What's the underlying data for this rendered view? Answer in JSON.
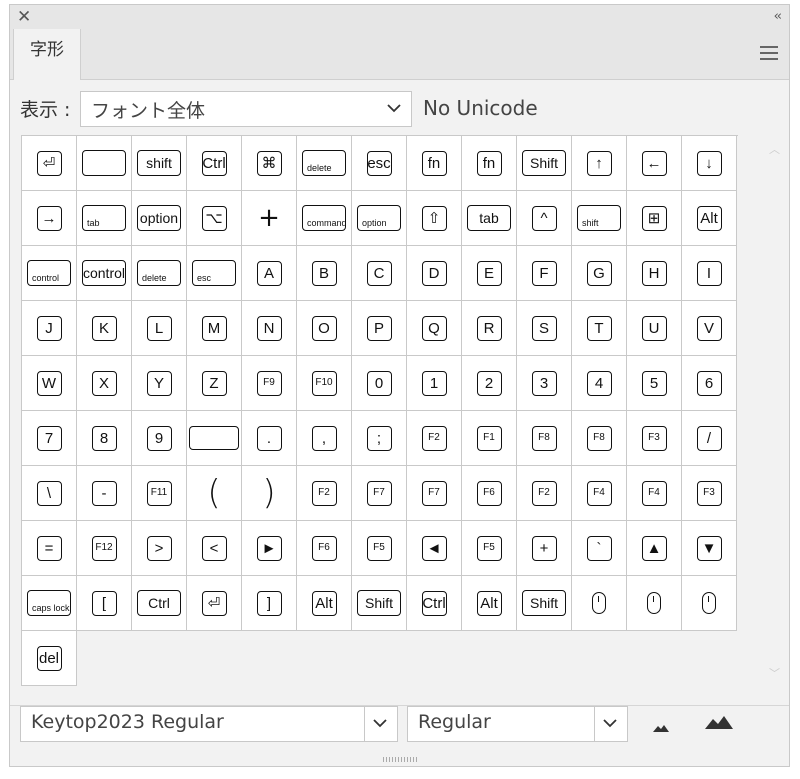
{
  "window": {
    "close_icon": "close-icon",
    "collapse_glyph": "‹‹"
  },
  "tab": {
    "label": "字形"
  },
  "show": {
    "label": "表示 :",
    "value": "フォント全体",
    "unicode": "No Unicode"
  },
  "glyphs": [
    {
      "t": "sq",
      "v": "⏎"
    },
    {
      "t": "blank"
    },
    {
      "t": "wide",
      "v": "shift"
    },
    {
      "t": "sq",
      "v": "Ctrl"
    },
    {
      "t": "sq",
      "v": "⌘"
    },
    {
      "t": "lbl",
      "v": "delete"
    },
    {
      "t": "sq",
      "v": "esc"
    },
    {
      "t": "sq",
      "v": "fn"
    },
    {
      "t": "sq",
      "v": "fn"
    },
    {
      "t": "wide",
      "v": "Shift"
    },
    {
      "t": "sq",
      "v": "↑"
    },
    {
      "t": "sq",
      "v": "←"
    },
    {
      "t": "sq",
      "v": "↓"
    },
    {
      "t": "sq",
      "v": "→"
    },
    {
      "t": "lbl",
      "v": "tab"
    },
    {
      "t": "wide",
      "v": "option"
    },
    {
      "t": "sq",
      "v": "⌥"
    },
    {
      "t": "plain",
      "v": "+"
    },
    {
      "t": "lbl",
      "v": "command"
    },
    {
      "t": "lbl",
      "v": "option"
    },
    {
      "t": "sq",
      "v": "⇧"
    },
    {
      "t": "wide",
      "v": "tab"
    },
    {
      "t": "sq",
      "v": "^"
    },
    {
      "t": "lbl",
      "v": "shift"
    },
    {
      "t": "sq",
      "v": "⊞"
    },
    {
      "t": "sq",
      "v": "Alt"
    },
    {
      "t": "lbl",
      "v": "control"
    },
    {
      "t": "wide",
      "v": "control"
    },
    {
      "t": "lbl",
      "v": "delete"
    },
    {
      "t": "lbl",
      "v": "esc"
    },
    {
      "t": "sq",
      "v": "A"
    },
    {
      "t": "sq",
      "v": "B"
    },
    {
      "t": "sq",
      "v": "C"
    },
    {
      "t": "sq",
      "v": "D"
    },
    {
      "t": "sq",
      "v": "E"
    },
    {
      "t": "sq",
      "v": "F"
    },
    {
      "t": "sq",
      "v": "G"
    },
    {
      "t": "sq",
      "v": "H"
    },
    {
      "t": "sq",
      "v": "I"
    },
    {
      "t": "sq",
      "v": "J"
    },
    {
      "t": "sq",
      "v": "K"
    },
    {
      "t": "sq",
      "v": "L"
    },
    {
      "t": "sq",
      "v": "M"
    },
    {
      "t": "sq",
      "v": "N"
    },
    {
      "t": "sq",
      "v": "O"
    },
    {
      "t": "sq",
      "v": "P"
    },
    {
      "t": "sq",
      "v": "Q"
    },
    {
      "t": "sq",
      "v": "R"
    },
    {
      "t": "sq",
      "v": "S"
    },
    {
      "t": "sq",
      "v": "T"
    },
    {
      "t": "sq",
      "v": "U"
    },
    {
      "t": "sq",
      "v": "V"
    },
    {
      "t": "sq",
      "v": "W"
    },
    {
      "t": "sq",
      "v": "X"
    },
    {
      "t": "sq",
      "v": "Y"
    },
    {
      "t": "sq",
      "v": "Z"
    },
    {
      "t": "fn",
      "v": "F9"
    },
    {
      "t": "fn",
      "v": "F10"
    },
    {
      "t": "sq",
      "v": "0"
    },
    {
      "t": "sq",
      "v": "1"
    },
    {
      "t": "sq",
      "v": "2"
    },
    {
      "t": "sq",
      "v": "3"
    },
    {
      "t": "sq",
      "v": "4"
    },
    {
      "t": "sq",
      "v": "5"
    },
    {
      "t": "sq",
      "v": "6"
    },
    {
      "t": "sq",
      "v": "7"
    },
    {
      "t": "sq",
      "v": "8"
    },
    {
      "t": "sq",
      "v": "9"
    },
    {
      "t": "xw",
      "v": ""
    },
    {
      "t": "sq",
      "v": "."
    },
    {
      "t": "sq",
      "v": ","
    },
    {
      "t": "sq",
      "v": ";"
    },
    {
      "t": "fn",
      "v": "F2"
    },
    {
      "t": "fn",
      "v": "F1"
    },
    {
      "t": "fn",
      "v": "F8"
    },
    {
      "t": "fn",
      "v": "F8"
    },
    {
      "t": "fn",
      "v": "F3"
    },
    {
      "t": "sq",
      "v": "/"
    },
    {
      "t": "sq",
      "v": "\\"
    },
    {
      "t": "sq",
      "v": "-"
    },
    {
      "t": "fn",
      "v": "F11"
    },
    {
      "t": "paren",
      "v": "("
    },
    {
      "t": "paren",
      "v": ")"
    },
    {
      "t": "fn",
      "v": "F2"
    },
    {
      "t": "fn",
      "v": "F7"
    },
    {
      "t": "fn",
      "v": "F7"
    },
    {
      "t": "fn",
      "v": "F6"
    },
    {
      "t": "fn",
      "v": "F2"
    },
    {
      "t": "fn",
      "v": "F4"
    },
    {
      "t": "fn",
      "v": "F4"
    },
    {
      "t": "fn",
      "v": "F3"
    },
    {
      "t": "sq",
      "v": "="
    },
    {
      "t": "fn",
      "v": "F12"
    },
    {
      "t": "sq",
      "v": ">"
    },
    {
      "t": "sq",
      "v": "<"
    },
    {
      "t": "sq",
      "v": "►"
    },
    {
      "t": "fn",
      "v": "F6"
    },
    {
      "t": "fn",
      "v": "F5"
    },
    {
      "t": "sq",
      "v": "◄"
    },
    {
      "t": "fn",
      "v": "F5"
    },
    {
      "t": "sq",
      "v": "+"
    },
    {
      "t": "sq",
      "v": "`"
    },
    {
      "t": "sq",
      "v": "▲"
    },
    {
      "t": "sq",
      "v": "▼"
    },
    {
      "t": "lbl",
      "v": "caps lock"
    },
    {
      "t": "sq",
      "v": "["
    },
    {
      "t": "wide",
      "v": "Ctrl"
    },
    {
      "t": "sq",
      "v": "⏎"
    },
    {
      "t": "sq",
      "v": "]"
    },
    {
      "t": "sq",
      "v": "Alt"
    },
    {
      "t": "wide",
      "v": "Shift"
    },
    {
      "t": "sq",
      "v": "Ctrl"
    },
    {
      "t": "sq",
      "v": "Alt"
    },
    {
      "t": "wide",
      "v": "Shift"
    },
    {
      "t": "mouse",
      "v": ""
    },
    {
      "t": "mouse",
      "v": ""
    },
    {
      "t": "mouse",
      "v": ""
    },
    {
      "t": "sq",
      "v": "del"
    }
  ],
  "font": {
    "family": "Keytop2023 Regular",
    "style": "Regular"
  },
  "colors": {
    "panel": "#f2f2f2",
    "cell": "#ffffff",
    "border": "#c9c9c9"
  }
}
